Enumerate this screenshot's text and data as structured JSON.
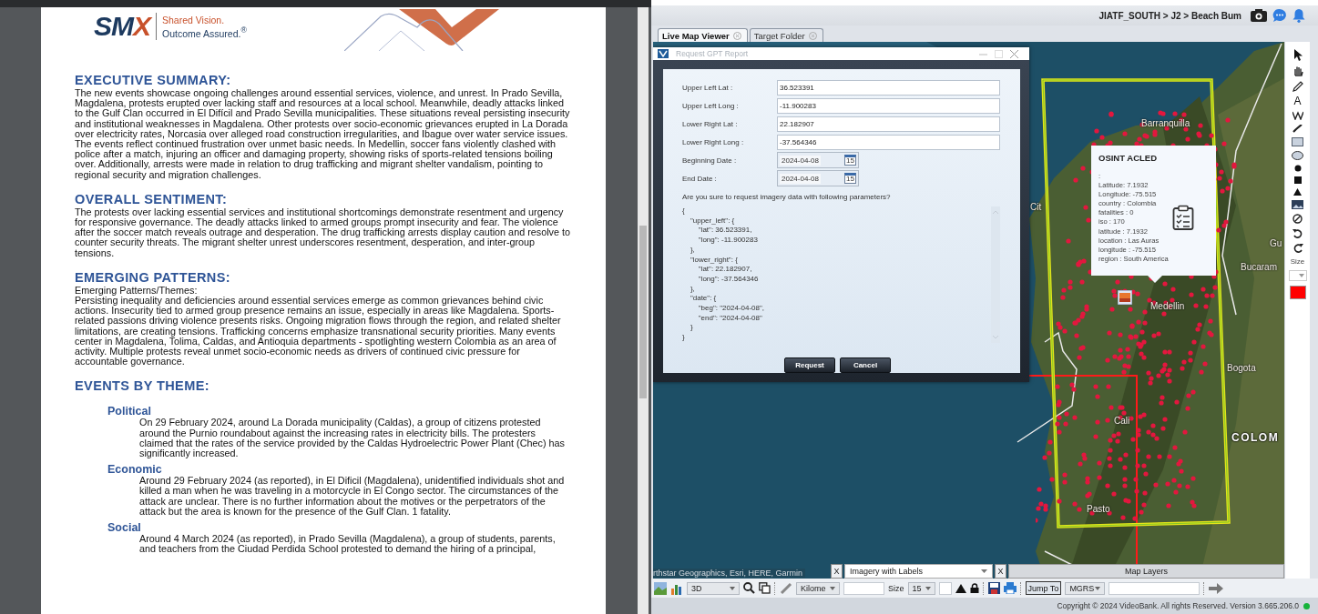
{
  "document": {
    "logo": {
      "brand": "SMX",
      "tagline": [
        "Shared Vision.",
        "Outcome Assured.$^{®}$"
      ]
    },
    "sections": [
      {
        "heading": "EXECUTIVE SUMMARY:",
        "paragraphs": [
          "The new events showcase ongoing challenges around essential services, violence, and unrest. In Prado Sevilla, Magdalena, protests erupted over lacking staff and resources at a local school. Meanwhile, deadly attacks linked to the Gulf Clan occurred in El Difícil and Prado Sevilla municipalities. These situations reveal persisting insecurity and institutional weaknesses in Magdalena. Other protests over socio-economic grievances erupted in La Dorada over electricity rates, Norcasia over alleged road construction irregularities, and Ibague over water service issues. The events reflect continued frustration over unmet basic needs. In Medellin, soccer fans violently clashed with police after a match, injuring an officer and damaging property, showing risks of sports-related tensions boiling over. Additionally, arrests were made in relation to drug trafficking and migrant shelter vandalism, pointing to regional security and migration challenges."
        ]
      },
      {
        "heading": "OVERALL SENTIMENT:",
        "paragraphs": [
          "The protests over lacking essential services and institutional shortcomings demonstrate resentment and urgency for responsive governance. The deadly attacks linked to armed groups prompt insecurity and fear. The violence after the soccer match reveals outrage and desperation. The drug trafficking arrests display caution and resolve to counter security threats. The migrant shelter unrest underscores resentment, desperation, and inter-group tensions."
        ]
      },
      {
        "heading": "EMERGING PATTERNS:",
        "paragraphs": [
          "Emerging Patterns/Themes:",
          "Persisting inequality and deficiencies around essential services emerge as common grievances behind civic actions. Insecurity tied to armed group presence remains an issue, especially in areas like Magdalena. Sports-related passions driving violence presents risks. Ongoing migration flows through the region, and related shelter limitations, are creating tensions. Trafficking concerns emphasize transnational security priorities. Many events center in Magdalena, Tolima, Caldas, and Antioquia departments - spotlighting western Colombia as an area of activity. Multiple protests reveal unmet socio-economic needs as drivers of continued civic pressure for accountable governance."
        ]
      },
      {
        "heading": "EVENTS BY THEME:",
        "themes": [
          {
            "name": "Political",
            "text": "On 29 February 2024, around La Dorada municipality (Caldas), a group of citizens protested around the Purnio roundabout against the increasing rates in electricity bills. The protesters claimed that the rates of the service provided by the Caldas Hydroelectric Power Plant (Chec) has significantly increased."
          },
          {
            "name": "Economic",
            "text": "Around 29 February 2024 (as reported), in El Dificil (Magdalena), unidentified individuals shot and killed a man when he was traveling in a motorcycle in El Congo sector. The circumstances of the attack are unclear. There is no further information about the motives or the perpetrators of the attack but the area is known for the presence of the Gulf Clan. 1 fatality."
          },
          {
            "name": "Social",
            "text": "Around 4 March 2024 (as reported), in Prado Sevilla (Magdalena), a group of students, parents, and teachers from the Ciudad Perdida School protested to demand the hiring of a principal,"
          }
        ]
      }
    ]
  },
  "app": {
    "header": {
      "breadcrumb": "JIATF_SOUTH > J2 > Beach Bum"
    },
    "tabs": [
      {
        "label": "Live Map Viewer",
        "selected": true
      },
      {
        "label": "Target Folder",
        "selected": false
      }
    ],
    "dialog": {
      "title": "Request GPT Report",
      "fields": [
        {
          "label": "Upper Left Lat :",
          "value": "36.523391",
          "kind": "text"
        },
        {
          "label": "Upper Left Long :",
          "value": "-11.900283",
          "kind": "text"
        },
        {
          "label": "Lower Right Lat :",
          "value": "22.182907",
          "kind": "text"
        },
        {
          "label": "Lower Right Long :",
          "value": "-37.564346",
          "kind": "text"
        },
        {
          "label": "Beginning Date :",
          "value": "2024-04-08",
          "kind": "date",
          "calendar_day": "15"
        },
        {
          "label": "End Date :",
          "value": "2024-04-08",
          "kind": "date",
          "calendar_day": "15"
        }
      ],
      "question": "Are you sure to request imagery data with following parameters?",
      "preview": "{\n    \"upper_left\": {\n        \"lat\": 36.523391,\n        \"long\": -11.900283\n    },\n    \"lower_right\": {\n        \"lat\": 22.182907,\n        \"long\": -37.564346\n    },\n    \"date\": {\n        \"beg\": \"2024-04-08\",\n        \"end\": \"2024-04-08\"\n    }\n}",
      "buttons": [
        "Request",
        "Cancel"
      ]
    },
    "popup": {
      "title": "OSINT ACLED",
      "lines": [
        ":",
        "Latitude: 7.1932",
        "Longitude: -75.515",
        "country : Colombia",
        "fatalities : 0",
        "iso : 170",
        "latitude : 7.1932",
        "location : Las Auras",
        "longitude : -75.515",
        "region : South America"
      ]
    },
    "map_labels": [
      {
        "text": "Barranquilla",
        "kind": "city"
      },
      {
        "text": "Cit",
        "kind": "city"
      },
      {
        "text": "Gu",
        "kind": "city"
      },
      {
        "text": "Bucaram",
        "kind": "city"
      },
      {
        "text": "Medellin",
        "kind": "city"
      },
      {
        "text": "Bogota",
        "kind": "city"
      },
      {
        "text": "Cali",
        "kind": "city"
      },
      {
        "text": "Pasto",
        "kind": "city"
      },
      {
        "text": "COLOM",
        "kind": "country"
      }
    ],
    "attribution": "rthstar Geographics, Esri, HERE, Garmin",
    "layer_bar": {
      "close_buttons": [
        "X",
        "X"
      ],
      "imagery_layer": "Imagery with Labels",
      "panel_title": "Map Layers"
    },
    "side_toolbar": {
      "text_tool": "A",
      "size_label": "Size",
      "color": "#ff0000"
    },
    "toolbar": {
      "view_mode": "3D",
      "unit": "Kilome",
      "size_label": "Size",
      "size": "15",
      "jump_button": "Jump To",
      "coord_system": "MGRS"
    },
    "status": {
      "copyright": "Copyright © 2024 VideoBank. All rights Reserved. Version 3.665.206.0",
      "online": true
    }
  }
}
